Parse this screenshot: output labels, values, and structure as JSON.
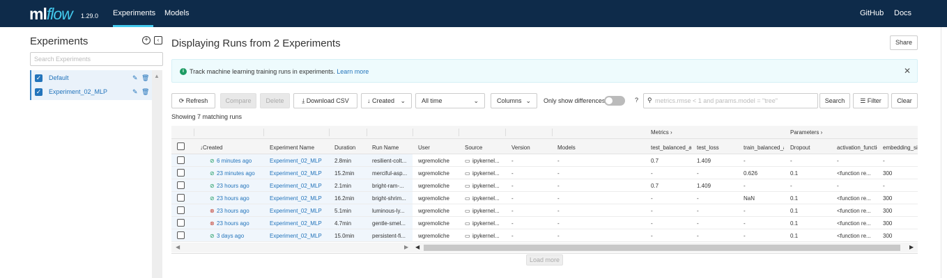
{
  "topbar": {
    "logo_ml": "ml",
    "logo_flow": "flow",
    "version": "1.29.0",
    "nav": [
      "Experiments",
      "Models"
    ],
    "right_links": [
      "GitHub",
      "Docs"
    ]
  },
  "sidebar": {
    "title": "Experiments",
    "search_placeholder": "Search Experiments",
    "experiments": [
      {
        "name": "Default",
        "checked": true
      },
      {
        "name": "Experiment_02_MLP",
        "checked": true
      }
    ]
  },
  "main": {
    "title": "Displaying Runs from 2 Experiments",
    "share_label": "Share",
    "banner_text": "Track machine learning training runs in experiments.",
    "banner_link": "Learn more",
    "toolbar": {
      "refresh": "Refresh",
      "compare": "Compare",
      "delete": "Delete",
      "download": "Download CSV",
      "sort": "Created",
      "time": "All time",
      "columns": "Columns",
      "only_diff": "Only show differences",
      "search_placeholder": "metrics.rmse < 1 and params.model = \"tree\"",
      "search": "Search",
      "filter": "Filter",
      "clear": "Clear"
    },
    "matching_text": "Showing 7 matching runs",
    "groups": {
      "metrics": "Metrics",
      "parameters": "Parameters"
    },
    "columns": [
      "Created",
      "Experiment Name",
      "Duration",
      "Run Name",
      "User",
      "Source",
      "Version",
      "Models",
      "test_balanced_accuracy",
      "test_loss",
      "train_balanced_accuracy",
      "Dropout",
      "activation_function",
      "embedding_size"
    ],
    "runs": [
      {
        "status": "ok",
        "created": "6 minutes ago",
        "experiment": "Experiment_02_MLP",
        "duration": "2.8min",
        "run_name": "resilient-colt...",
        "user": "wgremoliche",
        "source": "ipykernel...",
        "version": "-",
        "models": "-",
        "test_bal": "0.7",
        "test_loss": "1.409",
        "train_bal": "-",
        "dropout": "-",
        "activation": "-",
        "embedding": "-"
      },
      {
        "status": "ok",
        "created": "23 minutes ago",
        "experiment": "Experiment_02_MLP",
        "duration": "15.2min",
        "run_name": "merciful-asp...",
        "user": "wgremoliche",
        "source": "ipykernel...",
        "version": "-",
        "models": "-",
        "test_bal": "-",
        "test_loss": "-",
        "train_bal": "0.626",
        "dropout": "0.1",
        "activation": "<function re...",
        "embedding": "300"
      },
      {
        "status": "ok",
        "created": "23 hours ago",
        "experiment": "Experiment_02_MLP",
        "duration": "2.1min",
        "run_name": "bright-ram-...",
        "user": "wgremoliche",
        "source": "ipykernel...",
        "version": "-",
        "models": "-",
        "test_bal": "0.7",
        "test_loss": "1.409",
        "train_bal": "-",
        "dropout": "-",
        "activation": "-",
        "embedding": "-"
      },
      {
        "status": "ok",
        "created": "23 hours ago",
        "experiment": "Experiment_02_MLP",
        "duration": "16.2min",
        "run_name": "bright-shrim...",
        "user": "wgremoliche",
        "source": "ipykernel...",
        "version": "-",
        "models": "-",
        "test_bal": "-",
        "test_loss": "-",
        "train_bal": "NaN",
        "dropout": "0.1",
        "activation": "<function re...",
        "embedding": "300"
      },
      {
        "status": "fail",
        "created": "23 hours ago",
        "experiment": "Experiment_02_MLP",
        "duration": "5.1min",
        "run_name": "luminous-ly...",
        "user": "wgremoliche",
        "source": "ipykernel...",
        "version": "-",
        "models": "-",
        "test_bal": "-",
        "test_loss": "-",
        "train_bal": "-",
        "dropout": "0.1",
        "activation": "<function re...",
        "embedding": "300"
      },
      {
        "status": "fail",
        "created": "23 hours ago",
        "experiment": "Experiment_02_MLP",
        "duration": "4.7min",
        "run_name": "gentle-smel...",
        "user": "wgremoliche",
        "source": "ipykernel...",
        "version": "-",
        "models": "-",
        "test_bal": "-",
        "test_loss": "-",
        "train_bal": "-",
        "dropout": "0.1",
        "activation": "<function re...",
        "embedding": "300"
      },
      {
        "status": "ok",
        "created": "3 days ago",
        "experiment": "Experiment_02_MLP",
        "duration": "15.0min",
        "run_name": "persistent-fi...",
        "user": "wgremoliche",
        "source": "ipykernel...",
        "version": "-",
        "models": "-",
        "test_bal": "-",
        "test_loss": "-",
        "train_bal": "-",
        "dropout": "0.1",
        "activation": "<function re...",
        "embedding": "300"
      }
    ],
    "load_more": "Load more"
  },
  "colors": {
    "topbar": "#0e2b4a",
    "accent": "#43c9ed",
    "link": "#2374bb",
    "ok": "#1d9b63",
    "fail": "#c0392b"
  }
}
